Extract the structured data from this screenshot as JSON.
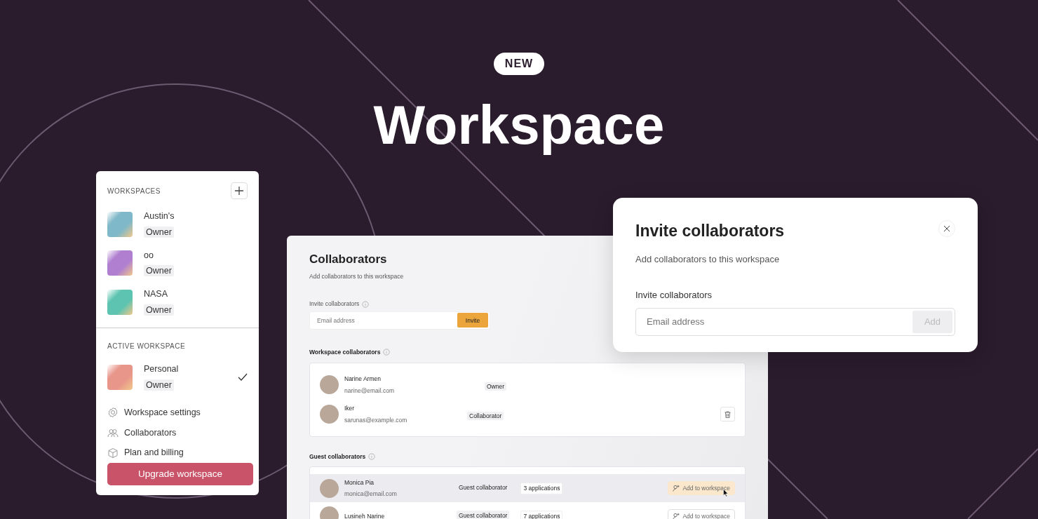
{
  "badge": "NEW",
  "headline": "Workspace",
  "workspace_menu": {
    "header": "WORKSPACES",
    "workspaces": [
      {
        "name": "Austin's",
        "role": "Owner",
        "color": "#7fb8c8"
      },
      {
        "name": "oo",
        "role": "Owner",
        "color": "#b07fd0"
      },
      {
        "name": "NASA",
        "role": "Owner",
        "color": "#5cc4b0"
      }
    ],
    "active_header": "ACTIVE WORKSPACE",
    "active": {
      "name": "Personal",
      "role": "Owner",
      "color": "#e8958a",
      "checked": true
    },
    "links": [
      {
        "kind": "gear",
        "label": "Workspace settings"
      },
      {
        "kind": "people",
        "label": "Collaborators"
      },
      {
        "kind": "box",
        "label": "Plan and billing"
      }
    ],
    "upgrade_button": "Upgrade workspace"
  },
  "collaborators_page": {
    "title": "Collaborators",
    "subtitle": "Add collaborators to this workspace",
    "invite_label": "Invite collaborators",
    "placeholder": "Email address",
    "invite_button": "Invite",
    "members_header": "Workspace collaborators",
    "members": [
      {
        "name": "Narine Armen",
        "email": "narine@email.com",
        "role": "Owner",
        "deletable": false
      },
      {
        "name": "Iker",
        "email": "sarunas@example.com",
        "role": "Collaborator",
        "deletable": true
      }
    ],
    "guests_header": "Guest collaborators",
    "guests": [
      {
        "name": "Monica Pia",
        "email": "monica@email.com",
        "role": "Guest collaborator",
        "apps": "3 applications",
        "action": "Add to workspace",
        "selected": true
      },
      {
        "name": "Lusineh Narine",
        "role": "Guest collaborator",
        "apps": "7 applications",
        "action": "Add to workspace",
        "selected": false
      }
    ]
  },
  "invite_dialog": {
    "title": "Invite collaborators",
    "subtitle": "Add collaborators to this workspace",
    "label": "Invite collaborators",
    "placeholder": "Email address",
    "add_button": "Add",
    "add_disabled": true
  }
}
